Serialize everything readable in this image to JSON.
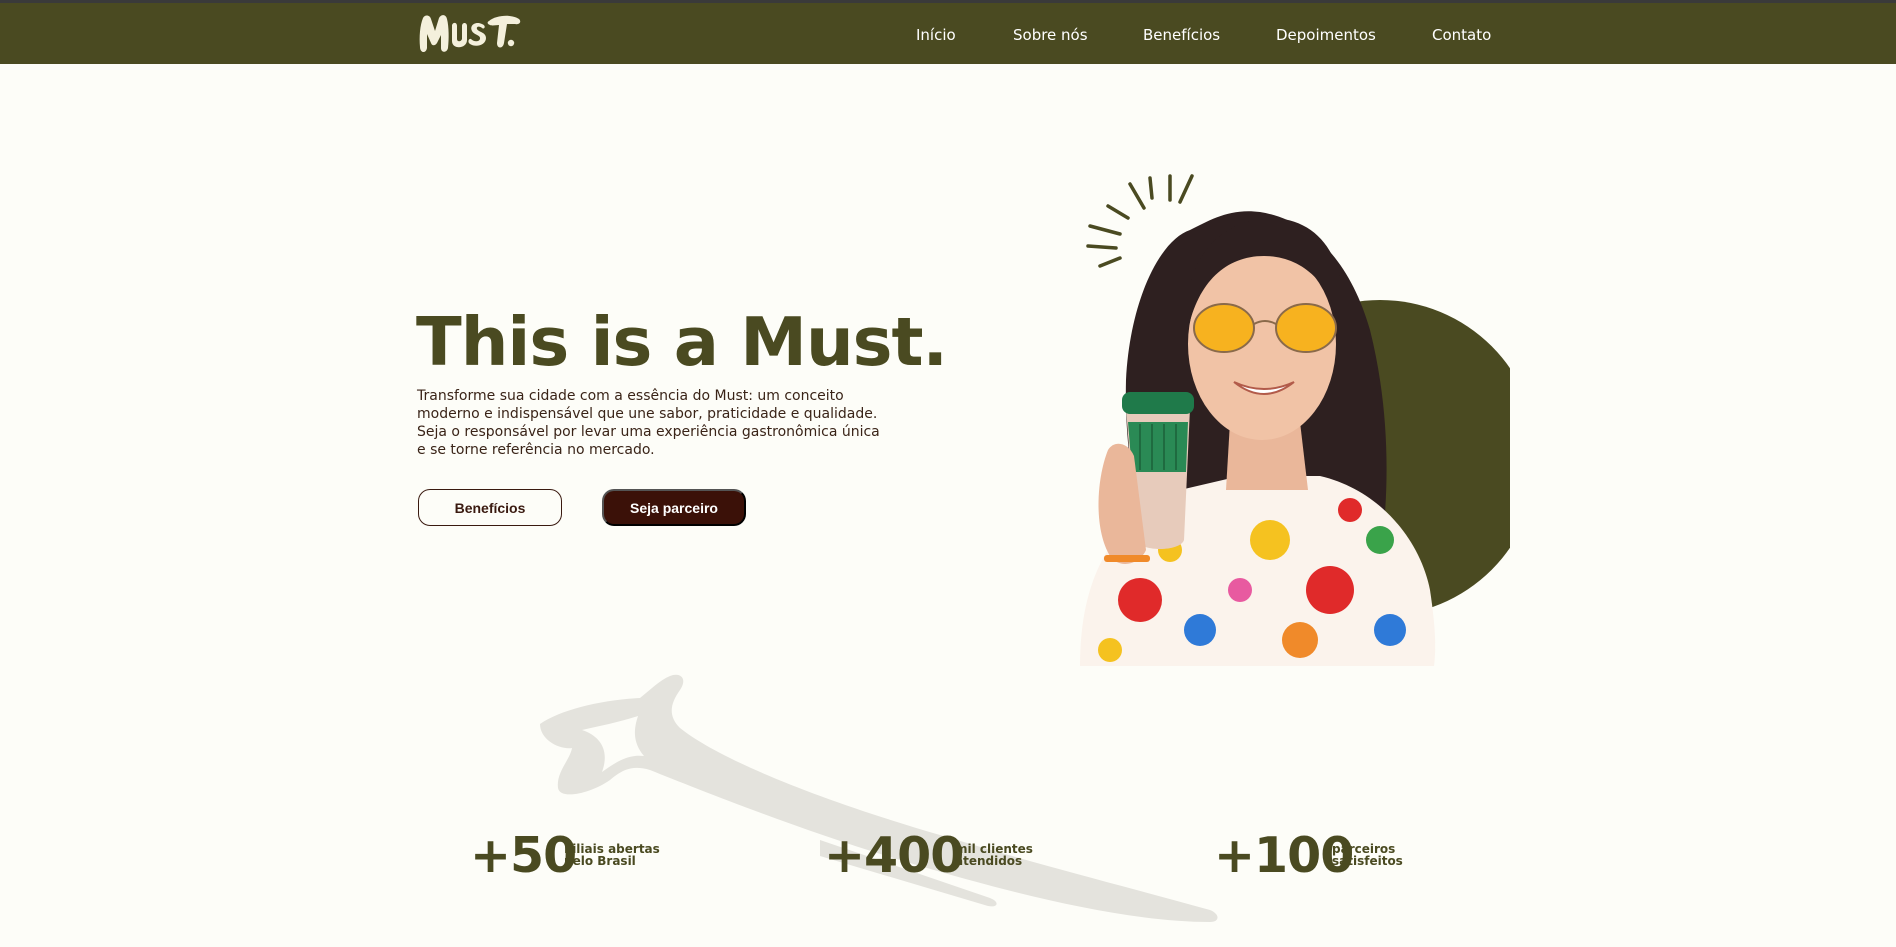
{
  "brand": {
    "logo_text": "Must.",
    "logo_color": "#f4f0dc",
    "accent": "#4a4a21",
    "dark": "#3b1108"
  },
  "nav": {
    "items": [
      {
        "label": "Início"
      },
      {
        "label": "Sobre nós"
      },
      {
        "label": "Benefícios"
      },
      {
        "label": "Depoimentos"
      },
      {
        "label": "Contato"
      }
    ]
  },
  "hero": {
    "title": "This is a Must.",
    "description": "Transforme sua cidade com a essência do Must: um conceito moderno e indispensável que une sabor, praticidade e qualidade. Seja o responsável por levar uma experiência gastronômica única e se torne referência no mercado.",
    "buttons": {
      "benefits": "Benefícios",
      "partner": "Seja parceiro"
    },
    "image": "smiling-woman-with-coffee-cup-icon"
  },
  "stats": [
    {
      "number": "+50",
      "label": "Filiais abertas pelo Brasil"
    },
    {
      "number": "+400",
      "label": "mil clientes atendidos"
    },
    {
      "number": "+100",
      "label": "parceiros satisfeitos"
    }
  ]
}
